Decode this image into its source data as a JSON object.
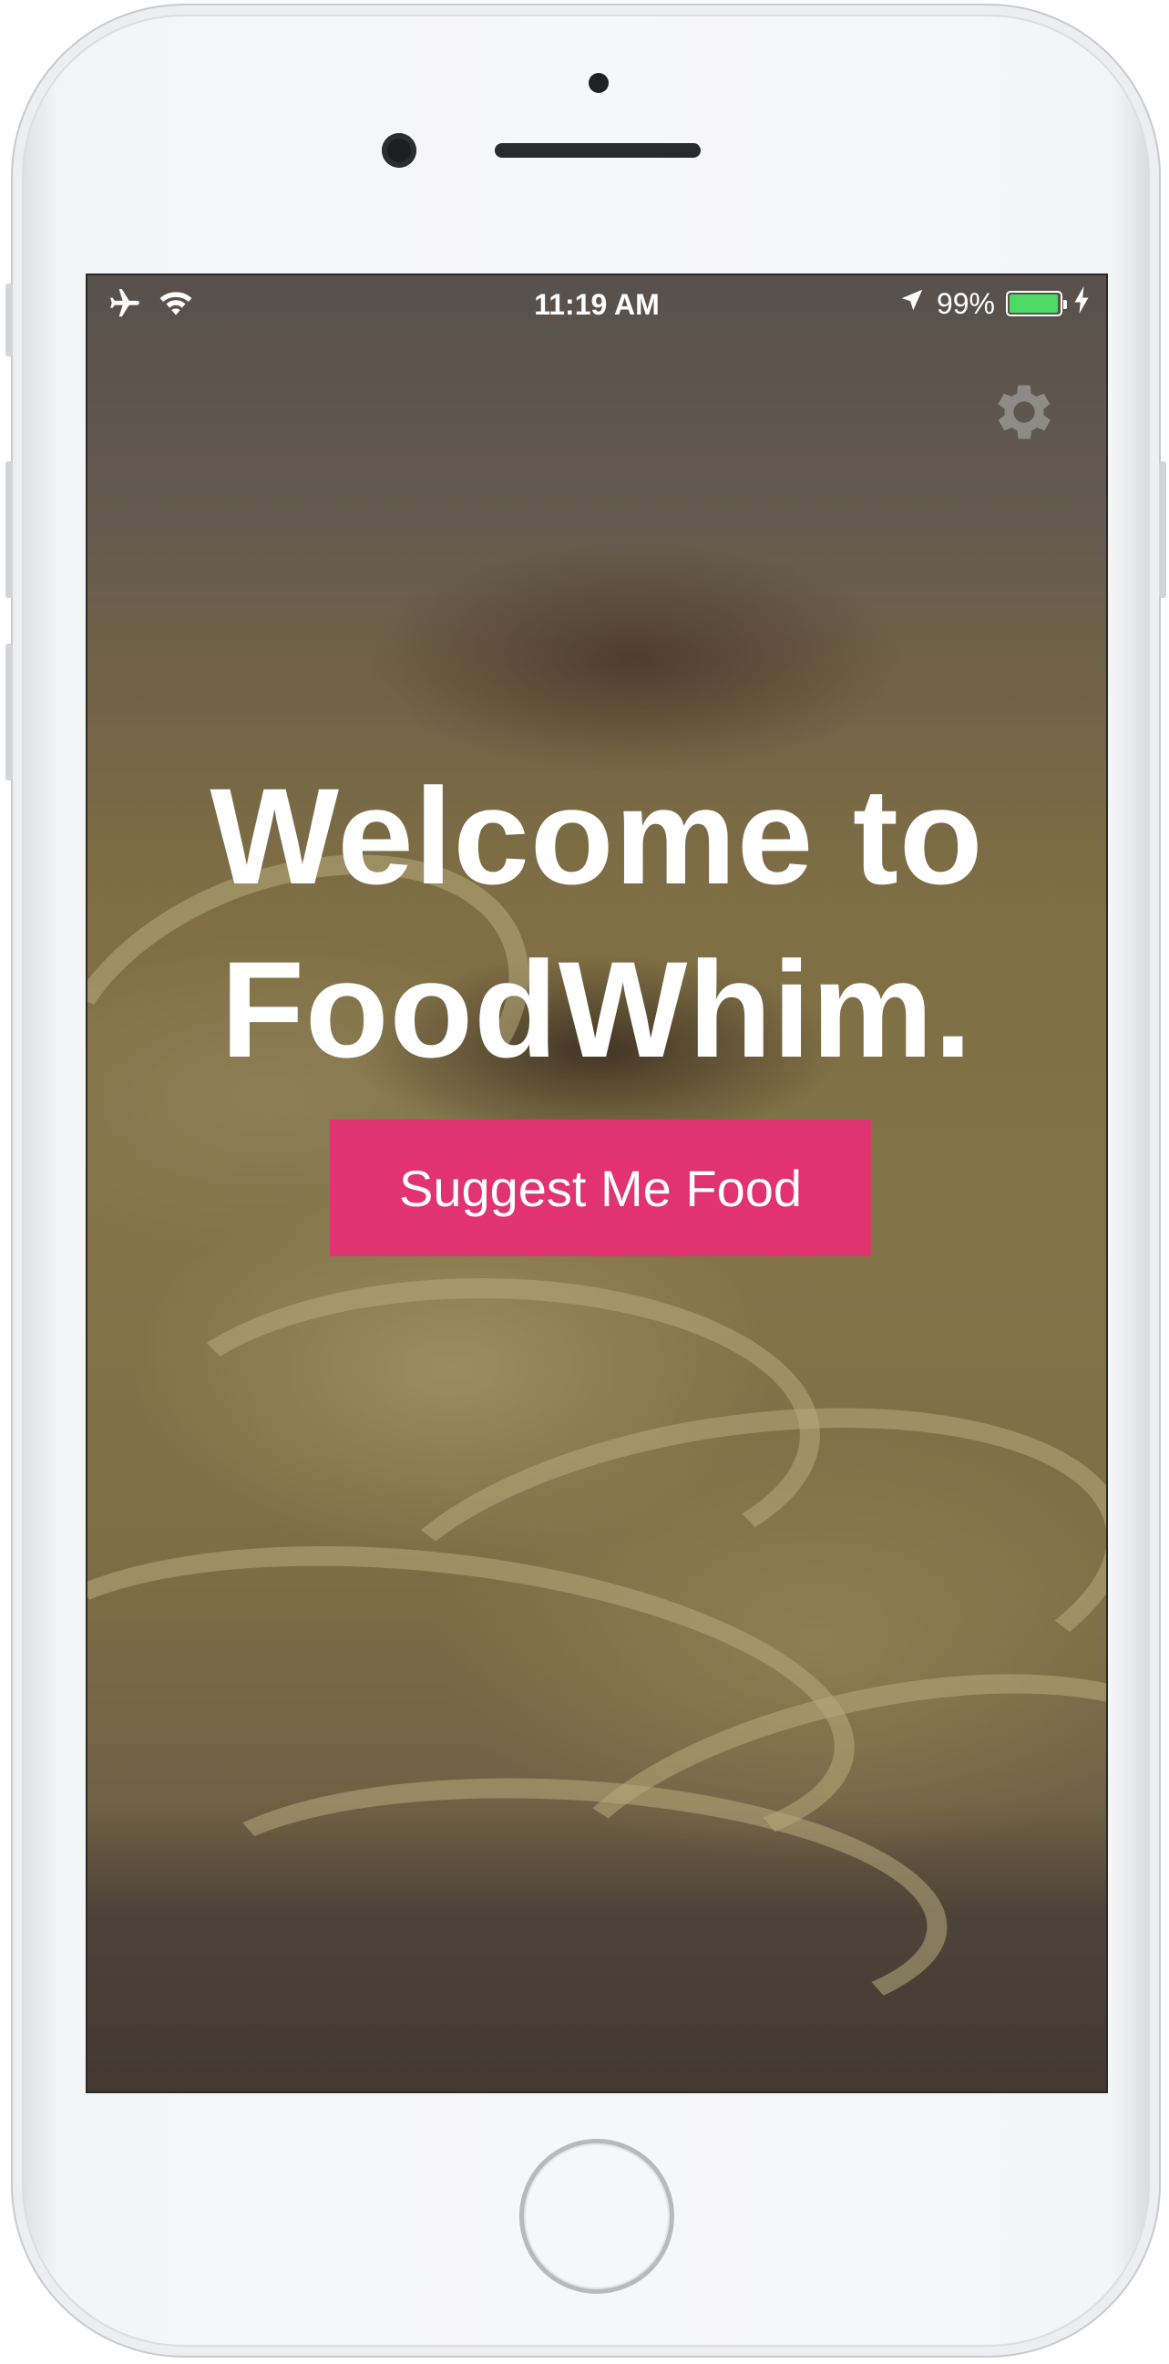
{
  "status_bar": {
    "time": "11:19 AM",
    "battery_percent_label": "99%",
    "battery_level": 0.99,
    "icons": [
      "airplane-icon",
      "wifi-icon",
      "location-arrow-icon",
      "battery-icon",
      "charging-bolt-icon"
    ]
  },
  "header": {
    "settings_icon": "gear-icon"
  },
  "hero": {
    "title_line1": "Welcome to",
    "title_line2": "FoodWhim.",
    "cta_label": "Suggest Me Food"
  },
  "colors": {
    "accent": "#e0336f",
    "battery_green": "#4cd964",
    "text": "#ffffff"
  }
}
